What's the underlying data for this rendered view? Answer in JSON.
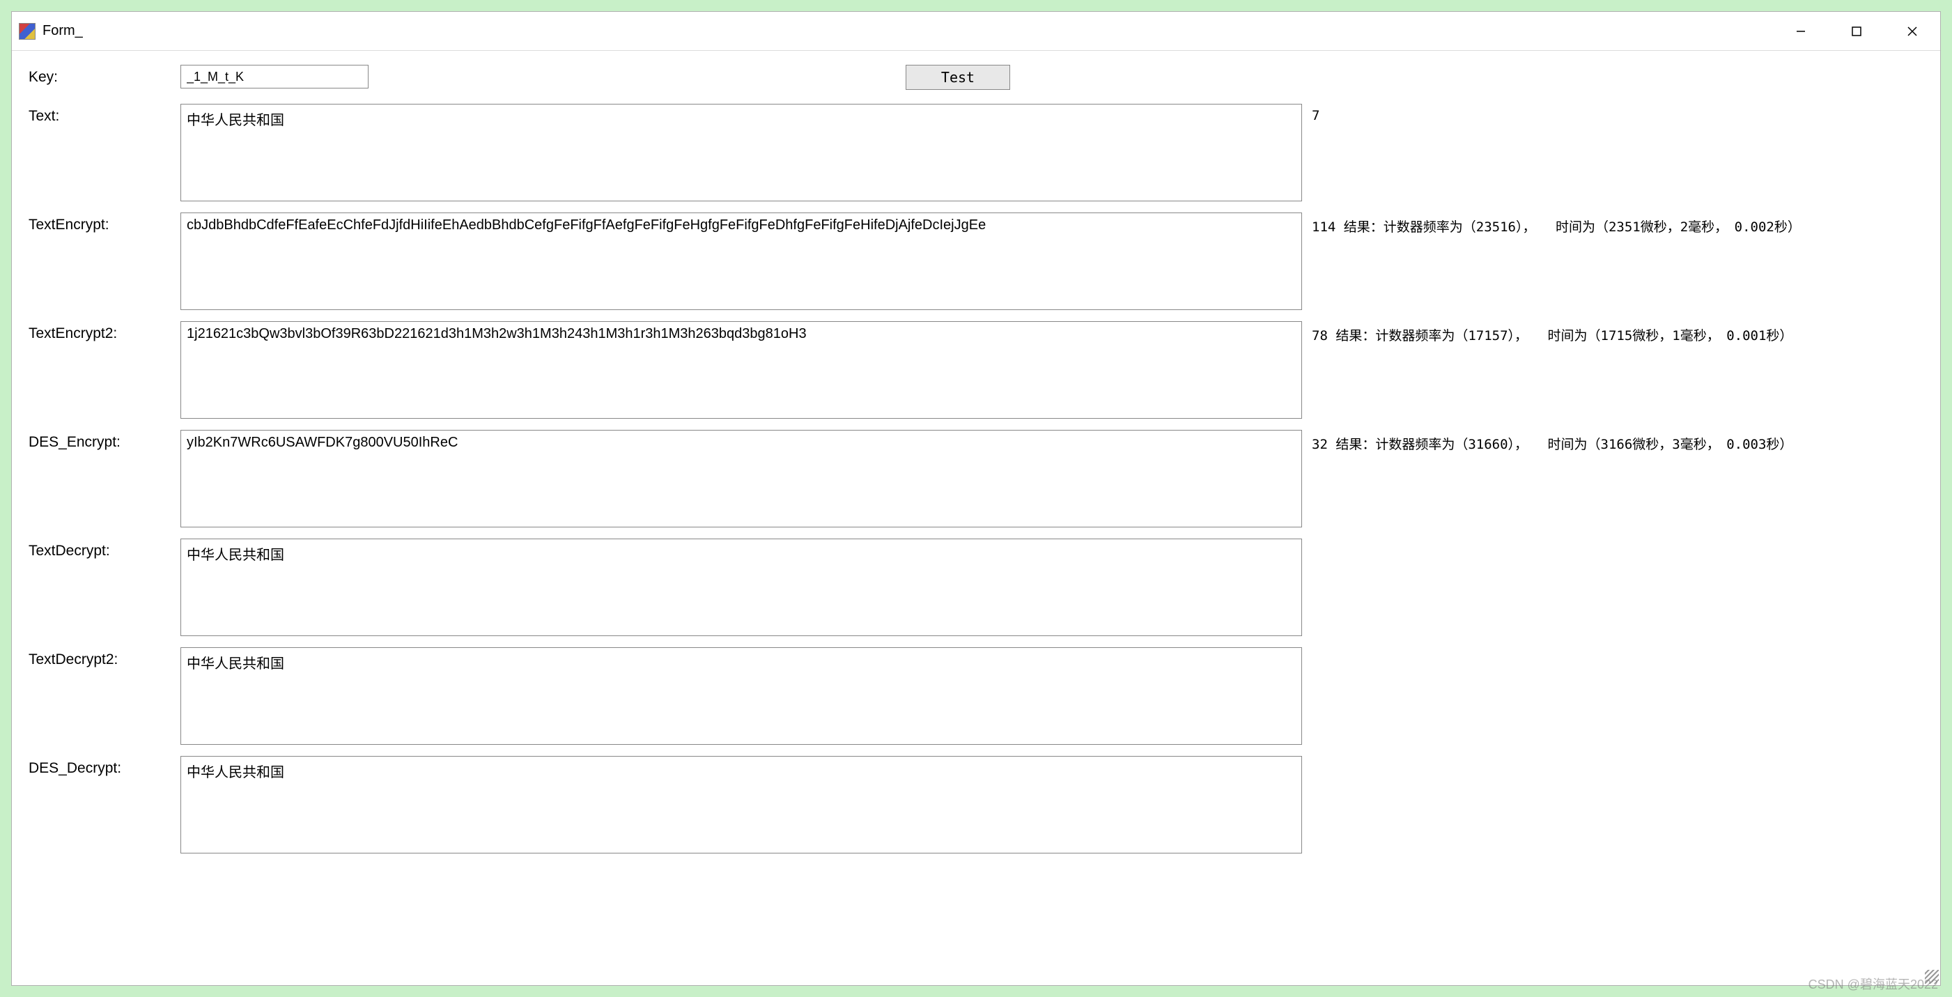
{
  "window": {
    "title": "Form_"
  },
  "toolbar": {
    "test_label": "Test"
  },
  "labels": {
    "key": "Key:",
    "text": "Text:",
    "text_encrypt": "TextEncrypt:",
    "text_encrypt2": "TextEncrypt2:",
    "des_encrypt": "DES_Encrypt:",
    "text_decrypt": "TextDecrypt:",
    "text_decrypt2": "TextDecrypt2:",
    "des_decrypt": "DES_Decrypt:"
  },
  "values": {
    "key": "_1_M_t_K",
    "text": "中华人民共和国",
    "text_encrypt": "cbJdbBhdbCdfeFfEafeEcChfeFdJjfdHiIifeEhAedbBhdbCefgFeFifgFfAefgFeFifgFeHgfgFeFifgFeDhfgFeFifgFeHifeDjAjfeDcIejJgEe",
    "text_encrypt2": "1j21621c3bQw3bvl3bOf39R63bD221621d3h1M3h2w3h1M3h243h1M3h1r3h1M3h263bqd3bg81oH3",
    "des_encrypt": "yIb2Kn7WRc6USAWFDK7g800VU50IhReC",
    "text_decrypt": "中华人民共和国",
    "text_decrypt2": "中华人民共和国",
    "des_decrypt": "中华人民共和国"
  },
  "info": {
    "text": "7",
    "text_encrypt": "114 结果：计数器频率为（23516），　　时间为（2351微秒，2毫秒，　0.002秒）",
    "text_encrypt2": "78 结果：计数器频率为（17157），　　时间为（1715微秒，1毫秒，　0.001秒）",
    "des_encrypt": "32 结果：计数器频率为（31660），　　时间为（3166微秒，3毫秒，　0.003秒）"
  },
  "watermark": "CSDN @碧海蓝天2022"
}
